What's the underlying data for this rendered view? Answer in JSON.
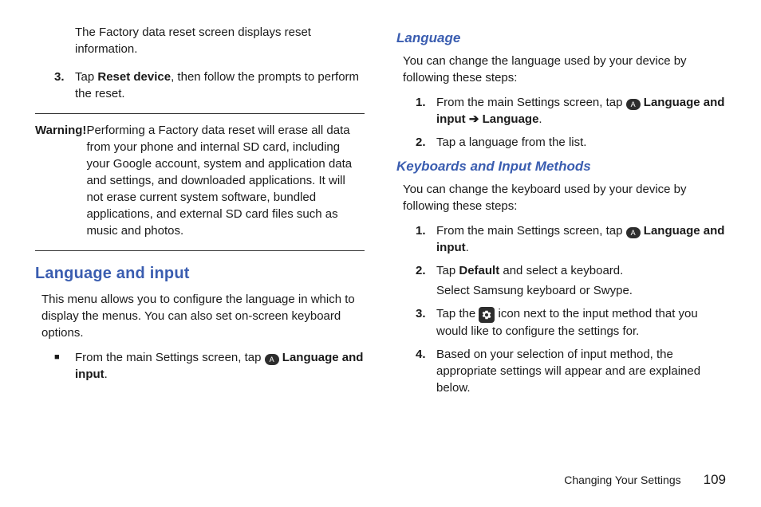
{
  "left": {
    "resetInfo": "The Factory data reset screen displays reset information.",
    "step3_num": "3.",
    "step3_a": "Tap ",
    "step3_b": "Reset device",
    "step3_c": ", then follow the prompts to perform the reset.",
    "warningLabel": "Warning!",
    "warningText": "Performing a Factory data reset will erase all data from your phone and internal SD card, including your Google account, system and application data and settings, and downloaded applications. It will not erase current system software, bundled applications, and external SD card files such as music and photos.",
    "h1": "Language and input",
    "intro": "This menu allows you to configure the language in which to display the menus. You can also set on-screen keyboard options.",
    "bullet_a": "From the main Settings screen, tap ",
    "bullet_iconLetter": "A",
    "bullet_b": " Language and input",
    "bullet_c": "."
  },
  "right": {
    "h2a": "Language",
    "introA": "You can change the language used by your device by following these steps:",
    "a1_num": "1.",
    "a1_a": "From the main Settings screen, tap ",
    "a_iconLetter": "A",
    "a1_b": " Language and input ",
    "a1_arrow": "➔",
    "a1_c": " Language",
    "a1_d": ".",
    "a2_num": "2.",
    "a2": "Tap a language from the list.",
    "h2b": "Keyboards and Input Methods",
    "introB": "You can change the keyboard used by your device by following these steps:",
    "b1_num": "1.",
    "b1_a": "From the main Settings screen, tap ",
    "b_iconLetter": "A",
    "b1_b": " Language and input",
    "b1_c": ".",
    "b2_num": "2.",
    "b2_a": "Tap ",
    "b2_b": "Default",
    "b2_c": " and select a keyboard.",
    "b2_sub": "Select Samsung keyboard or Swype.",
    "b3_num": "3.",
    "b3_a": "Tap the ",
    "b3_b": " icon next to the input method that you would like to configure the settings for.",
    "b4_num": "4.",
    "b4": "Based on your selection of input method, the appropriate settings will appear and are explained below."
  },
  "footer": {
    "section": "Changing Your Settings",
    "page": "109"
  }
}
